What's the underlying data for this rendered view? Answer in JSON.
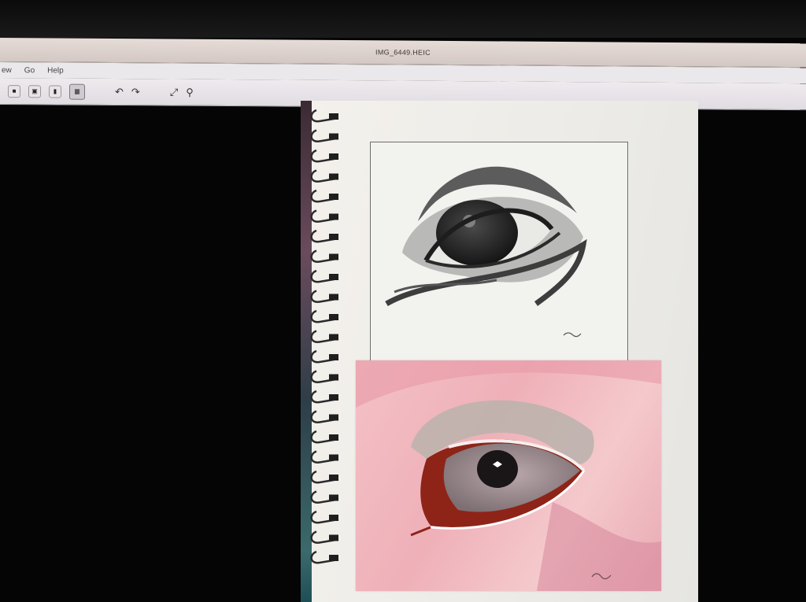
{
  "window": {
    "title": "IMG_6449.HEIC"
  },
  "menu": {
    "items": [
      "ew",
      "Go",
      "Help"
    ]
  },
  "toolbar": {
    "buttons": [
      "view-single",
      "view-double",
      "view-info",
      "view-grid-active"
    ],
    "icons": [
      "rotate-left-icon",
      "rotate-right-icon",
      "fullscreen-icon",
      "markup-icon"
    ]
  },
  "photo": {
    "description_none": "",
    "signature_top": "",
    "signature_bottom": ""
  },
  "colors": {
    "titlebar": "#dcd2cd",
    "toolbar": "#e8e4e8",
    "pink": "#efb0b8"
  }
}
